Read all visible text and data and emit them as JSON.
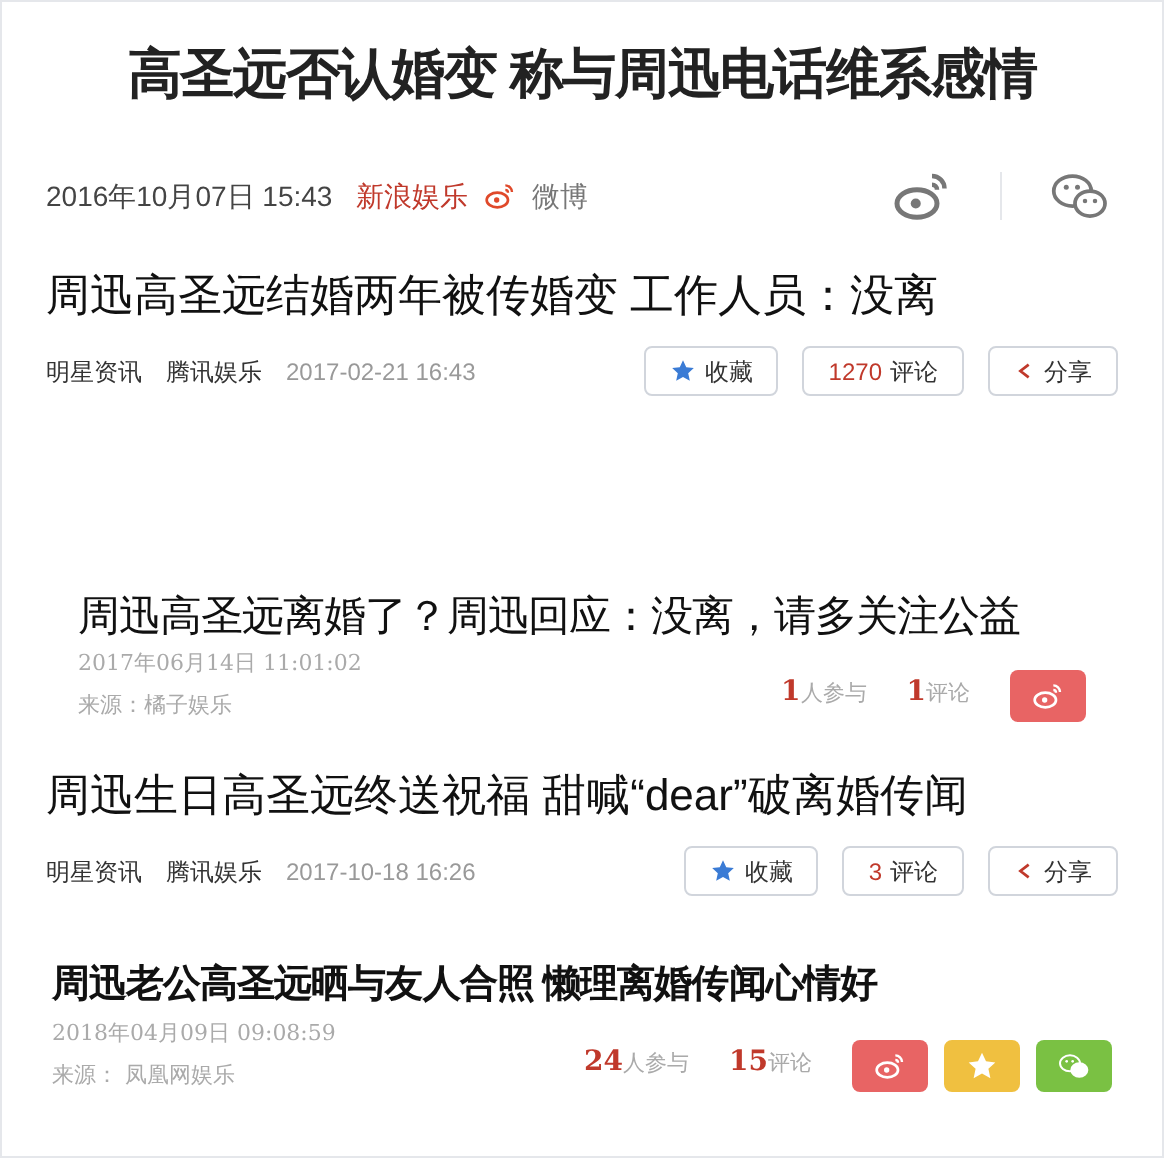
{
  "headline": "高圣远否认婚变 称与周迅电话维系感情",
  "byline": {
    "date": "2016年10月07日 15:43",
    "source": "新浪娱乐",
    "weibo": "微博"
  },
  "articles": [
    {
      "kind": "tencent",
      "title": "周迅高圣远结婚两年被传婚变 工作人员：没离",
      "channel": "明星资讯",
      "source": "腾讯娱乐",
      "time": "2017-02-21 16:43",
      "buttons": [
        {
          "kind": "favorite",
          "label": "收藏"
        },
        {
          "kind": "comments",
          "count": "1270",
          "label": "评论"
        },
        {
          "kind": "share",
          "label": "分享"
        }
      ]
    },
    {
      "kind": "portal",
      "title": "周迅高圣远离婚了？周迅回应：没离，请多关注公益",
      "time": "2017年06月14日  11:01:02",
      "source": "来源：橘子娱乐",
      "participants": "1",
      "participants_label": "人参与",
      "comments": "1",
      "comments_label": "评论",
      "share_buttons": [
        {
          "kind": "weibo"
        }
      ]
    },
    {
      "kind": "tencent",
      "title": "周迅生日高圣远终送祝福 甜喊“dear”破离婚传闻",
      "channel": "明星资讯",
      "source": "腾讯娱乐",
      "time": "2017-10-18 16:26",
      "buttons": [
        {
          "kind": "favorite",
          "label": "收藏"
        },
        {
          "kind": "comments",
          "count": "3",
          "label": "评论"
        },
        {
          "kind": "share",
          "label": "分享"
        }
      ]
    },
    {
      "kind": "portal",
      "title": "周迅老公高圣远晒与友人合照 懒理离婚传闻心情好",
      "time": "2018年04月09日 09:08:59",
      "source": "来源：  凤凰网娱乐",
      "participants": "24",
      "participants_label": "人参与",
      "comments": "15",
      "comments_label": "评论",
      "share_buttons": [
        {
          "kind": "weibo"
        },
        {
          "kind": "favorite"
        },
        {
          "kind": "wechat"
        }
      ]
    }
  ]
}
